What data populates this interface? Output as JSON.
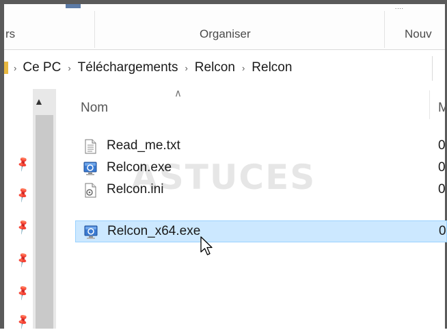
{
  "ribbon": {
    "groups": [
      {
        "label": "rs"
      },
      {
        "label": "Organiser"
      },
      {
        "label": "Nouv"
      }
    ],
    "top_fragment": "...."
  },
  "address": {
    "crumbs": [
      "Ce PC",
      "Téléchargements",
      "Relcon",
      "Relcon"
    ]
  },
  "file_list": {
    "columns": {
      "name": "Nom",
      "next": "M"
    },
    "files": [
      {
        "name": "Read_me.txt",
        "icon": "text-file-icon",
        "date": "0",
        "selected": false
      },
      {
        "name": "Relcon.exe",
        "icon": "exe-app-icon",
        "date": "0",
        "selected": false
      },
      {
        "name": "Relcon.ini",
        "icon": "ini-settings-file-icon",
        "date": "0",
        "selected": false
      },
      {
        "name": "Relcon_x64.exe",
        "icon": "exe-app-icon",
        "date": "0",
        "selected": true
      }
    ]
  },
  "watermark": {
    "text": "ASTUCES"
  },
  "colors": {
    "selection_bg": "#cce8ff",
    "selection_border": "#99d1ff",
    "frame": "#5a5a5a"
  }
}
